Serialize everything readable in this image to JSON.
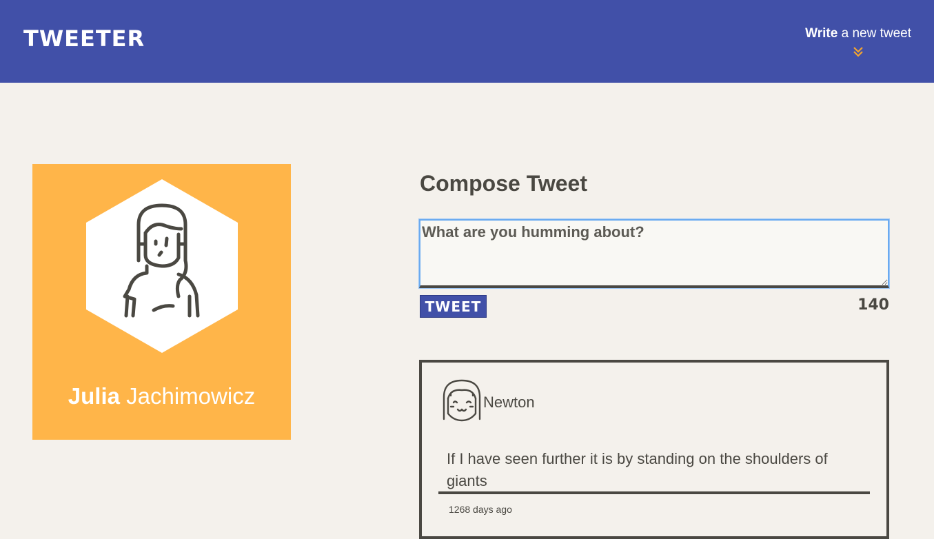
{
  "header": {
    "brand": "TWEETER",
    "compose_toggle_bold": "Write",
    "compose_toggle_rest": " a new tweet",
    "toggle_icon": "double-chevron-down-icon",
    "colors": {
      "bar": "#4150a8",
      "accent": "#f4a52e"
    }
  },
  "profile": {
    "first_name": "Julia",
    "last_name": " Jachimowicz",
    "avatar_icon": "user-avatar-icon",
    "background": "#ffb549"
  },
  "compose": {
    "title": "Compose Tweet",
    "placeholder": "What are you humming about?",
    "value": "",
    "submit_label": "TWEET",
    "char_count": "140"
  },
  "tweets": [
    {
      "avatar_icon": "newton-avatar-icon",
      "handle": "Newton",
      "text": "If I have seen further it is by standing on the shoulders of giants",
      "timestamp": "1268 days ago"
    }
  ]
}
